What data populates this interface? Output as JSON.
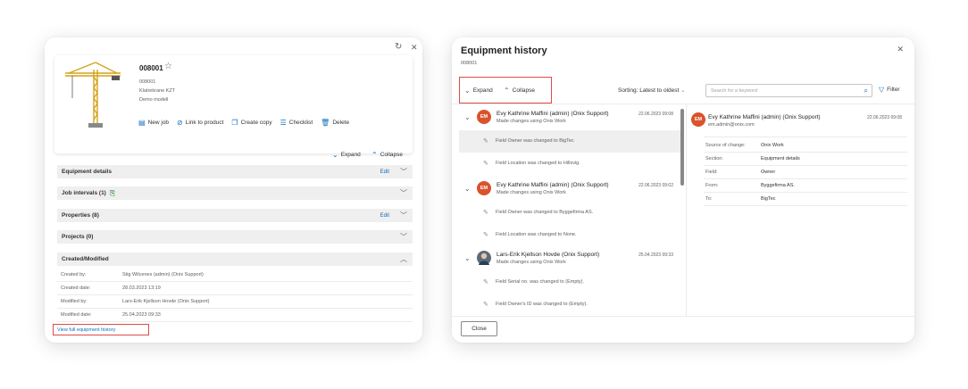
{
  "left_panel": {
    "equipment_number": "008001",
    "meta_lines": [
      "008001",
      "Klatrekrane KZT",
      "Demo modell"
    ],
    "actions": [
      {
        "label": "New job",
        "icon": "clipboard-icon"
      },
      {
        "label": "Link to product",
        "icon": "link-icon"
      },
      {
        "label": "Create copy",
        "icon": "copy-icon"
      },
      {
        "label": "Checklist",
        "icon": "checklist-icon"
      },
      {
        "label": "Delete",
        "icon": "trash-icon"
      }
    ],
    "expand_label": "Expand",
    "collapse_label": "Collapse",
    "sections": [
      {
        "title": "Equipment details",
        "edit": "Edit",
        "chevron": "down"
      },
      {
        "title": "Job intervals (1)",
        "edit": "",
        "chevron": "down"
      },
      {
        "title": "Properties (8)",
        "edit": "Edit",
        "chevron": "down"
      },
      {
        "title": "Projects (0)",
        "edit": "",
        "chevron": "down"
      },
      {
        "title": "Created/Modified",
        "edit": "",
        "chevron": "up"
      }
    ],
    "created_modified": [
      {
        "label": "Created by:",
        "value": "Stig Wilcenes (admin) (Onix Support)"
      },
      {
        "label": "Created date:",
        "value": "28.03.2023 13:19"
      },
      {
        "label": "Modified by:",
        "value": "Lars-Erik Kjellson Hovde (Onix Support)"
      },
      {
        "label": "Modified date:",
        "value": "25.04.2023 09:33"
      }
    ],
    "view_history_link": "View full equipment history"
  },
  "dialog": {
    "title": "Equipment history",
    "subtitle": "008001",
    "expand_label": "Expand",
    "collapse_label": "Collapse",
    "sorting_label": "Sorting: Latest to oldest",
    "search_placeholder": "Search for a keyword",
    "filter_label": "Filter",
    "close_button": "Close",
    "history": [
      {
        "initials": "EM",
        "name": "Evy Kathrine Maffini (admin) (Onix Support)",
        "made": "Made changes using Onix Work",
        "date": "22.06.2023 09:08",
        "changes": [
          "Field Owner was changed to BigTec",
          "Field Location was changed to Hillsvig."
        ]
      },
      {
        "initials": "EM",
        "name": "Evy Kathrine Maffini (admin) (Onix Support)",
        "made": "Made changes using Onix Work",
        "date": "22.06.2023 09:02",
        "changes": [
          "Field Owner was changed to Byggefirma AS.",
          "Field Location was changed to None."
        ]
      },
      {
        "initials": "",
        "name": "Lars-Erik Kjellson Hovde (Onix Support)",
        "made": "Made changes using Onix Work",
        "date": "25.04.2023 09:33",
        "changes": [
          "Field Serial no. was changed to (Empty).",
          "Field Owner's ID was changed to (Empty)."
        ]
      }
    ],
    "detail": {
      "initials": "EM",
      "name": "Evy Kathrine Maffini (admin) (Onix Support)",
      "email": "em.admin@onix.com",
      "date": "22.06.2023 09:08",
      "rows": [
        {
          "label": "Source of change:",
          "value": "Onix Work"
        },
        {
          "label": "Section:",
          "value": "Equipment details"
        },
        {
          "label": "Field:",
          "value": "Owner"
        },
        {
          "label": "From:",
          "value": "Byggefirma AS."
        },
        {
          "label": "To:",
          "value": "BigTec"
        }
      ]
    }
  },
  "colors": {
    "accent": "#0f6cbd",
    "highlight_box": "#e04a4a",
    "avatar": "#d9532c",
    "section_bg": "#efefef"
  }
}
